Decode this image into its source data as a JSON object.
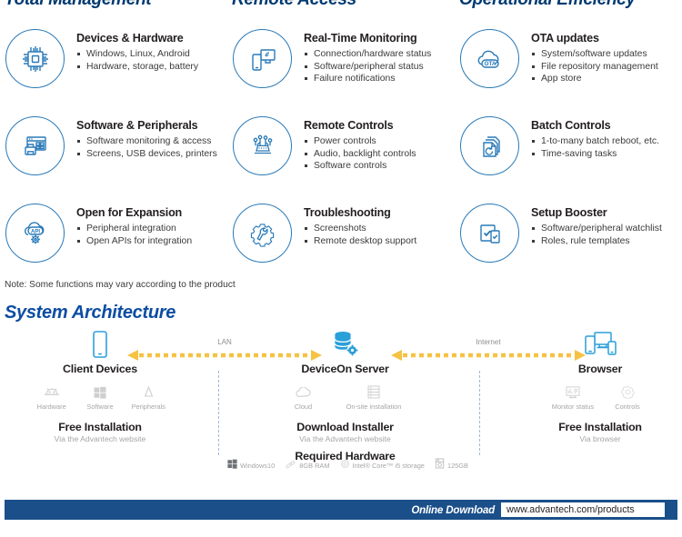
{
  "columns": [
    {
      "title": "Total Management"
    },
    {
      "title": "Remote Access"
    },
    {
      "title": "Operational Efficiency"
    }
  ],
  "features": [
    {
      "icon": "cpu-chip-icon",
      "title": "Devices & Hardware",
      "bullets": [
        "Windows, Linux, Android",
        "Hardware, storage, battery"
      ]
    },
    {
      "icon": "realtime-monitor-icon",
      "title": "Real-Time Monitoring",
      "bullets": [
        "Connection/hardware status",
        "Software/peripheral status",
        "Failure notifications"
      ]
    },
    {
      "icon": "ota-cloud-icon",
      "title": "OTA updates",
      "bullets": [
        "System/software updates",
        "File repository management",
        "App store"
      ]
    },
    {
      "icon": "software-peripherals-icon",
      "title": "Software & Peripherals",
      "bullets": [
        "Software monitoring & access",
        "Screens, USB devices, printers"
      ]
    },
    {
      "icon": "remote-controls-icon",
      "title": "Remote Controls",
      "bullets": [
        "Power controls",
        "Audio, backlight controls",
        "Software controls"
      ]
    },
    {
      "icon": "batch-controls-icon",
      "title": "Batch Controls",
      "bullets": [
        "1-to-many batch reboot, etc.",
        "Time-saving tasks"
      ]
    },
    {
      "icon": "api-expansion-icon",
      "title": "Open for Expansion",
      "bullets": [
        "Peripheral integration",
        "Open APIs for integration"
      ]
    },
    {
      "icon": "troubleshooting-gear-wrench-icon",
      "title": "Troubleshooting",
      "bullets": [
        "Screenshots",
        "Remote desktop support"
      ]
    },
    {
      "icon": "setup-booster-icon",
      "title": "Setup Booster",
      "bullets": [
        "Software/peripheral watchlist",
        "Roles, rule templates"
      ]
    }
  ],
  "note": "Note: Some functions may vary according to the product",
  "architecture": {
    "heading": "System Architecture",
    "client": {
      "icon": "tablet-device-icon",
      "title": "Client Devices",
      "sub_items": [
        {
          "icon": "android-robot-icon",
          "label": "Hardware"
        },
        {
          "icon": "windows-logo-icon",
          "label": "Software"
        },
        {
          "icon": "peripherals-drop-icon",
          "label": "Peripherals"
        }
      ],
      "block_title": "Free Installation",
      "block_sub": "Via the Advantech website"
    },
    "server": {
      "icon": "database-gear-icon",
      "title": "DeviceOn Server",
      "sub_items": [
        {
          "icon": "cloud-icon",
          "label": "Cloud"
        },
        {
          "icon": "onsite-server-rack-icon",
          "label": "On-site installation"
        }
      ],
      "block_title": "Download Installer",
      "block_sub": "Via the Advantech website",
      "hardware_title": "Required Hardware",
      "hardware_items": [
        {
          "icon": "windows-logo-icon",
          "label": "Windows10"
        },
        {
          "icon": "ram-stick-icon",
          "label": "8GB RAM"
        },
        {
          "icon": "cpu-icon",
          "label": "Intel® Core™ i5 storage"
        },
        {
          "icon": "hard-drive-icon",
          "label": "125GB"
        }
      ]
    },
    "browser": {
      "icon": "multi-device-browser-icon",
      "title": "Browser",
      "sub_items": [
        {
          "icon": "monitor-status-icon",
          "label": "Monitor status"
        },
        {
          "icon": "controls-gear-icon",
          "label": "Controls"
        }
      ],
      "block_title": "Free Installation",
      "block_sub": "Via browser"
    },
    "connections": [
      {
        "label": "LAN"
      },
      {
        "label": "Internet"
      }
    ]
  },
  "footer": {
    "label": "Online Download",
    "url": "www.advantech.com/products"
  },
  "colors": {
    "brand_dark_blue": "#003a70",
    "heading_blue": "#0c4da2",
    "icon_blue": "#2a7ab8",
    "arrow_yellow": "#f5c243",
    "footer_bar": "#1a4f8a",
    "muted_gray": "#a6a6a6"
  }
}
